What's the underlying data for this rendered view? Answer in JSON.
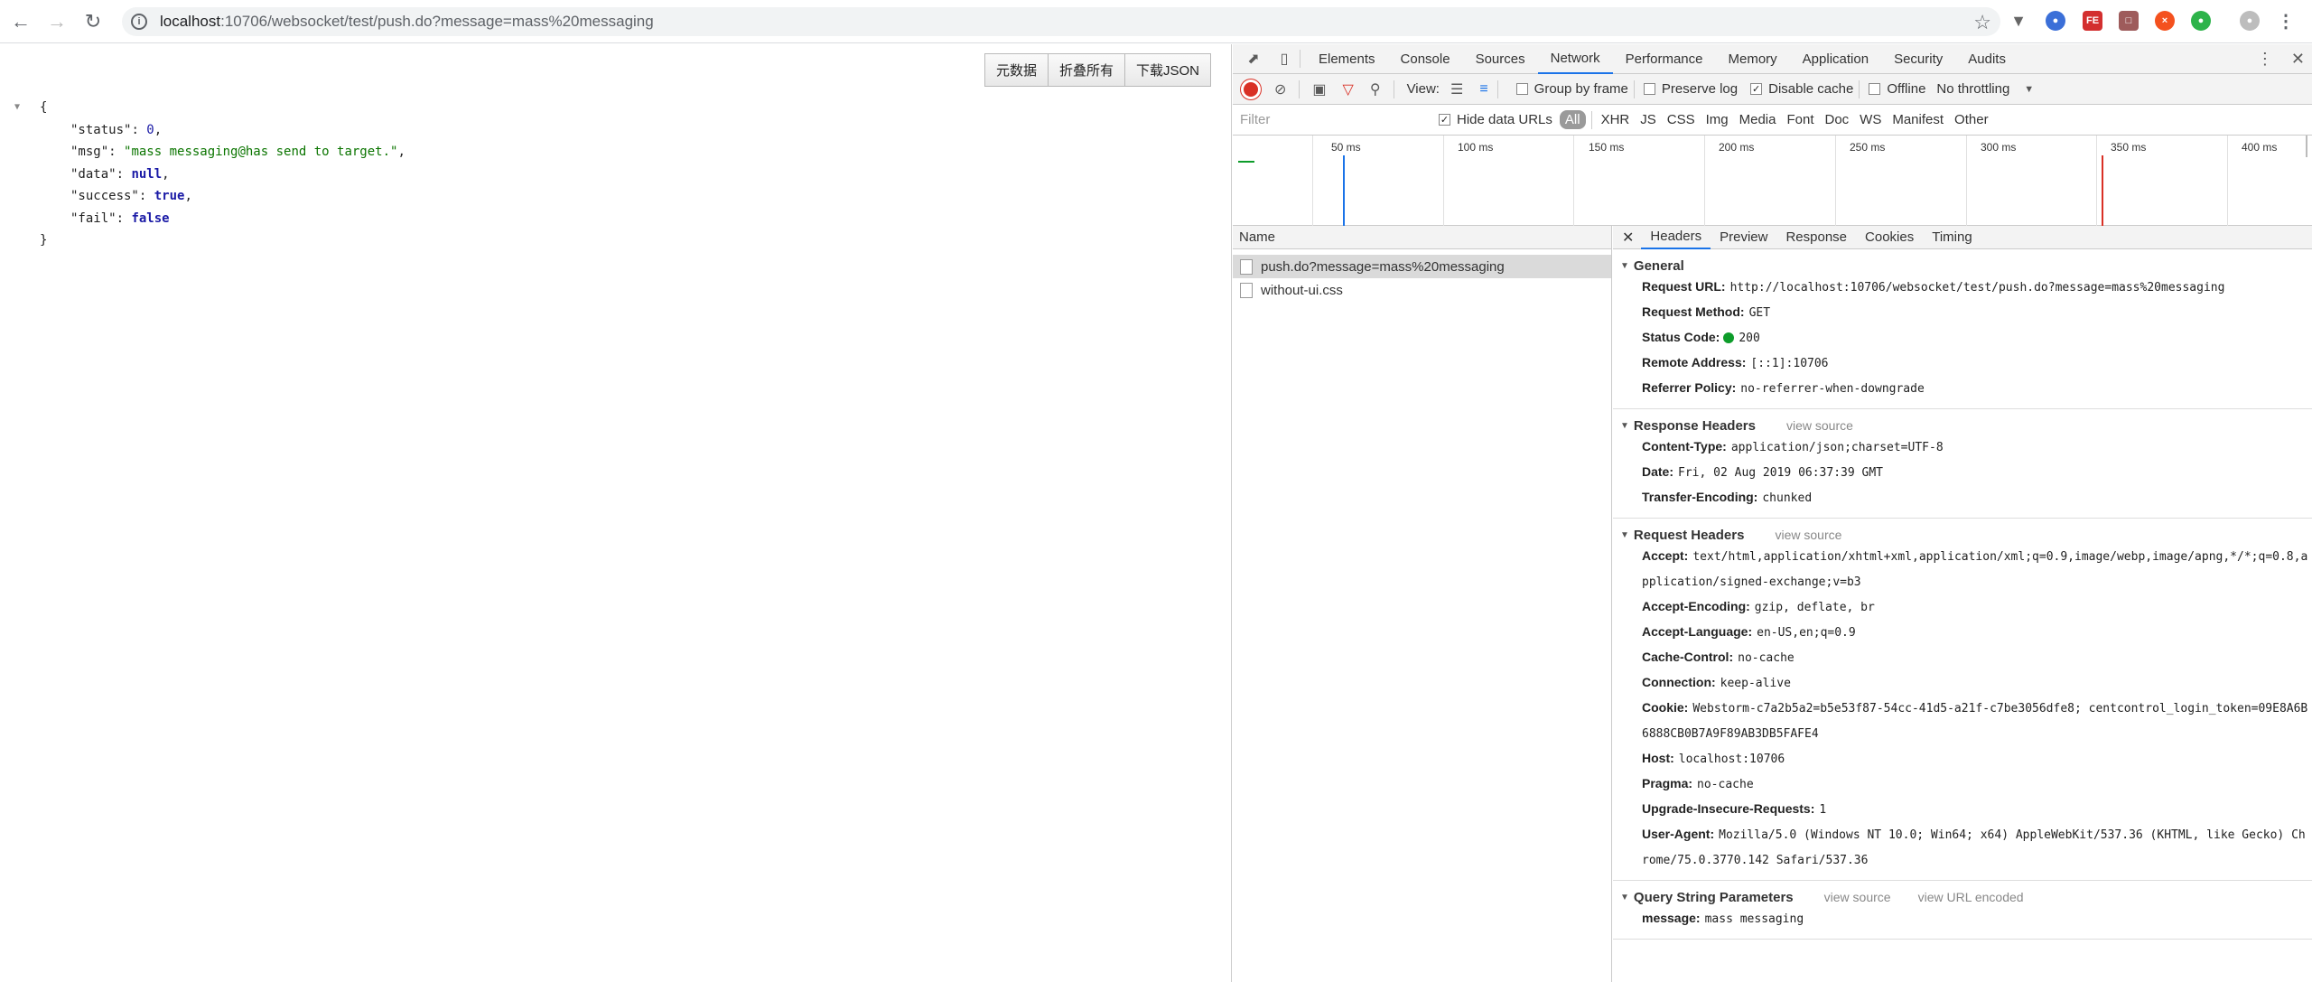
{
  "browser": {
    "url_host": "localhost",
    "url_rest": ":10706/websocket/test/push.do?message=mass%20messaging"
  },
  "json_viewer": {
    "buttons": [
      "元数据",
      "折叠所有",
      "下载JSON"
    ],
    "open_brace": "{",
    "close_brace": "}",
    "lines": [
      {
        "key": "\"status\"",
        "value": "0",
        "type": "num",
        "comma": ","
      },
      {
        "key": "\"msg\"",
        "value": "\"mass messaging@has send to target.\"",
        "type": "str",
        "comma": ","
      },
      {
        "key": "\"data\"",
        "value": "null",
        "type": "kw",
        "comma": ","
      },
      {
        "key": "\"success\"",
        "value": "true",
        "type": "kw",
        "comma": ","
      },
      {
        "key": "\"fail\"",
        "value": "false",
        "type": "kw",
        "comma": ""
      }
    ]
  },
  "devtools": {
    "tabs": [
      "Elements",
      "Console",
      "Sources",
      "Network",
      "Performance",
      "Memory",
      "Application",
      "Security",
      "Audits"
    ],
    "active_tab": "Network",
    "controls": {
      "view_label": "View:",
      "group_by_frame": "Group by frame",
      "preserve_log": "Preserve log",
      "disable_cache": "Disable cache",
      "offline": "Offline",
      "throttling": "No throttling"
    },
    "filter": {
      "placeholder": "Filter",
      "hide_data_urls": "Hide data URLs",
      "types": [
        "All",
        "XHR",
        "JS",
        "CSS",
        "Img",
        "Media",
        "Font",
        "Doc",
        "WS",
        "Manifest",
        "Other"
      ]
    },
    "timeline_ticks": [
      "50 ms",
      "100 ms",
      "150 ms",
      "200 ms",
      "250 ms",
      "300 ms",
      "350 ms",
      "400 ms"
    ],
    "list_header": "Name",
    "requests": [
      "push.do?message=mass%20messaging",
      "without-ui.css"
    ],
    "detail_tabs": [
      "Headers",
      "Preview",
      "Response",
      "Cookies",
      "Timing"
    ],
    "general": {
      "title": "General",
      "rows": [
        {
          "k": "Request URL:",
          "v": "http://localhost:10706/websocket/test/push.do?message=mass%20messaging"
        },
        {
          "k": "Request Method:",
          "v": "GET"
        },
        {
          "k": "Status Code:",
          "v": "200"
        },
        {
          "k": "Remote Address:",
          "v": "[::1]:10706"
        },
        {
          "k": "Referrer Policy:",
          "v": "no-referrer-when-downgrade"
        }
      ]
    },
    "response_headers": {
      "title": "Response Headers",
      "view_source": "view source",
      "rows": [
        {
          "k": "Content-Type:",
          "v": "application/json;charset=UTF-8"
        },
        {
          "k": "Date:",
          "v": "Fri, 02 Aug 2019 06:37:39 GMT"
        },
        {
          "k": "Transfer-Encoding:",
          "v": "chunked"
        }
      ]
    },
    "request_headers": {
      "title": "Request Headers",
      "view_source": "view source",
      "rows": [
        {
          "k": "Accept:",
          "v": "text/html,application/xhtml+xml,application/xml;q=0.9,image/webp,image/apng,*/*;q=0.8,application/signed-exchange;v=b3"
        },
        {
          "k": "Accept-Encoding:",
          "v": "gzip, deflate, br"
        },
        {
          "k": "Accept-Language:",
          "v": "en-US,en;q=0.9"
        },
        {
          "k": "Cache-Control:",
          "v": "no-cache"
        },
        {
          "k": "Connection:",
          "v": "keep-alive"
        },
        {
          "k": "Cookie:",
          "v": "Webstorm-c7a2b5a2=b5e53f87-54cc-41d5-a21f-c7be3056dfe8; centcontrol_login_token=09E8A6B6888CB0B7A9F89AB3DB5FAFE4"
        },
        {
          "k": "Host:",
          "v": "localhost:10706"
        },
        {
          "k": "Pragma:",
          "v": "no-cache"
        },
        {
          "k": "Upgrade-Insecure-Requests:",
          "v": "1"
        },
        {
          "k": "User-Agent:",
          "v": "Mozilla/5.0 (Windows NT 10.0; Win64; x64) AppleWebKit/537.36 (KHTML, like Gecko) Chrome/75.0.3770.142 Safari/537.36"
        }
      ]
    },
    "query_params": {
      "title": "Query String Parameters",
      "view_source": "view source",
      "view_url_encoded": "view URL encoded",
      "rows": [
        {
          "k": "message:",
          "v": "mass messaging"
        }
      ]
    }
  }
}
